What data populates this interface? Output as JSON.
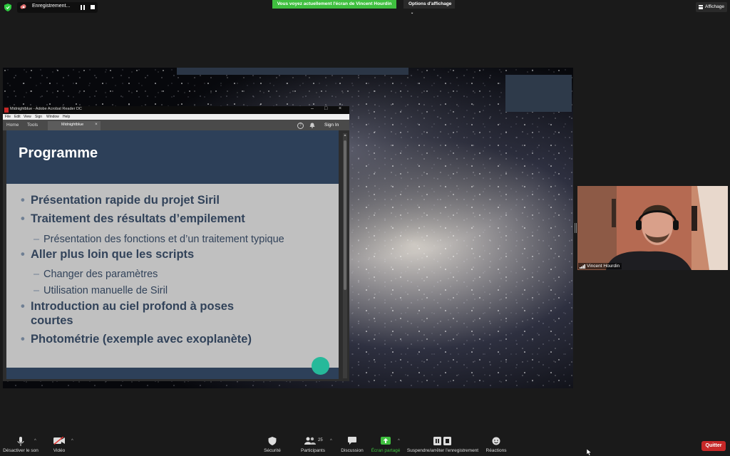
{
  "status": {
    "recording_label": "Enregistrement...",
    "banner": "Vous voyez actuellement l'écran de Vincent Hourdin",
    "view_options": "Options d'affichage",
    "display_label": "Affichage"
  },
  "acrobat": {
    "window_title": "Midnightblue - Adobe Acrobat Reader DC",
    "menu": [
      "File",
      "Edit",
      "View",
      "Sign",
      "Window",
      "Help"
    ],
    "tab_home": "Home",
    "tab_tools": "Tools",
    "doc_tab": "Midnightblue",
    "doc_tab_close": "×",
    "signin": "Sign In",
    "help": "?"
  },
  "slide": {
    "title": "Programme",
    "bullets": [
      {
        "level": 1,
        "text": "Présentation rapide du projet Siril"
      },
      {
        "level": 1,
        "text": "Traitement des résultats d’empilement"
      },
      {
        "level": 2,
        "text": "Présentation des fonctions et d’un traitement typique"
      },
      {
        "level": 1,
        "text": "Aller plus loin que les scripts"
      },
      {
        "level": 2,
        "text": "Changer des paramètres"
      },
      {
        "level": 2,
        "text": "Utilisation manuelle de Siril"
      },
      {
        "level": 1,
        "text": "Introduction au ciel profond à poses"
      },
      {
        "level": 0,
        "text": "courtes"
      },
      {
        "level": 1,
        "text": "Photométrie (exemple avec exoplanète)"
      }
    ]
  },
  "participant": {
    "name": "Vincent Hourdin"
  },
  "toolbar": {
    "mute": "Désactiver le son",
    "video": "Vidéo",
    "security": "Sécurité",
    "participants": "Participants",
    "participants_count": "25",
    "chat": "Discussion",
    "share": "Écran partagé",
    "record": "Suspendre/arrêter l'enregistrement",
    "reactions": "Réactions",
    "quit": "Quitter"
  },
  "colors": {
    "accent_green": "#3fbf3f",
    "slide_header": "#2d4059",
    "slide_text": "#32435a",
    "slide_dot": "#26b99a",
    "quit_red": "#c62828"
  }
}
